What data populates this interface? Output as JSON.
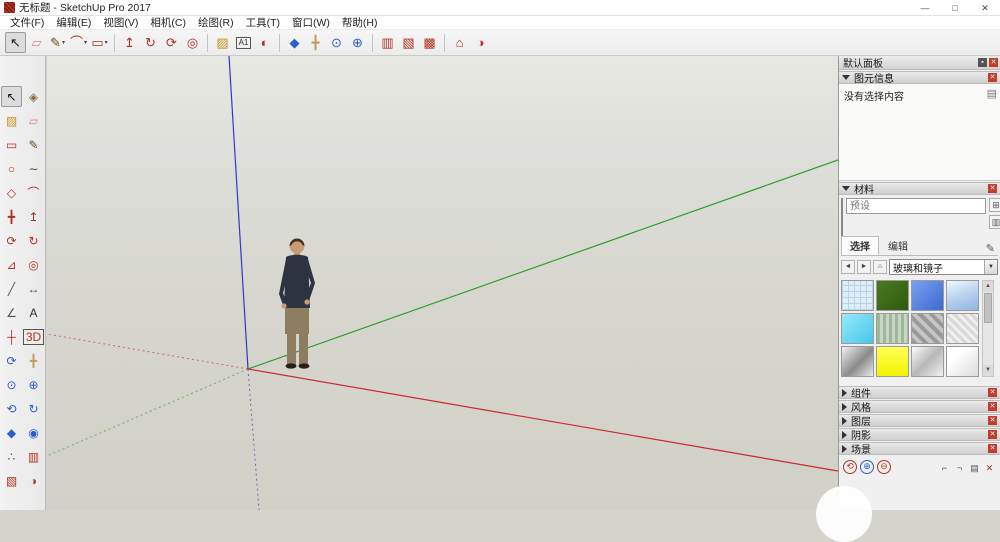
{
  "ui": {
    "minimize_glyph": "—",
    "maximize_glyph": "□",
    "close_glyph": "✕",
    "pin_glyph": "▪",
    "caret_small": "▾",
    "dropdown_caret": "▼",
    "back_arrow": "◄",
    "forward_arrow": "►",
    "home_glyph": "⌂",
    "pencil_glyph": "✎",
    "detail_toggle_glyph": "▤",
    "scroll_up": "▲",
    "scroll_down": "▼",
    "create_material_glyph": "⊞",
    "secondary_pane_glyph": "▥"
  },
  "titlebar": {
    "title": "无标题 - SketchUp Pro 2017"
  },
  "menu": {
    "items": [
      {
        "name": "menu-file",
        "label": "文件(F)"
      },
      {
        "name": "menu-edit",
        "label": "编辑(E)"
      },
      {
        "name": "menu-view",
        "label": "视图(V)"
      },
      {
        "name": "menu-camera",
        "label": "相机(C)"
      },
      {
        "name": "menu-draw",
        "label": "绘图(R)"
      },
      {
        "name": "menu-tools",
        "label": "工具(T)"
      },
      {
        "name": "menu-window",
        "label": "窗口(W)"
      },
      {
        "name": "menu-help",
        "label": "帮助(H)"
      }
    ]
  },
  "toolbar": {
    "items": [
      {
        "name": "select-tool-button",
        "glyph": "↖",
        "color": "#1a1a1a",
        "pressed": true
      },
      {
        "name": "eraser-tool-button",
        "glyph": "▱",
        "color": "#d87f7f"
      },
      {
        "name": "line-tool-button",
        "glyph": "✎",
        "color": "#6b4a1a",
        "caret": true
      },
      {
        "name": "arc-tool-button",
        "glyph": "⌒",
        "color": "#b23220",
        "caret": true
      },
      {
        "name": "rectangle-tool-button",
        "glyph": "▭",
        "color": "#b23220",
        "caret": true
      },
      {
        "type": "sep"
      },
      {
        "name": "push-pull-tool-button",
        "glyph": "↥",
        "color": "#b23220"
      },
      {
        "name": "follow-me-tool-button",
        "glyph": "↻",
        "color": "#b23220"
      },
      {
        "name": "rotate-tool-button",
        "glyph": "⟳",
        "color": "#b23220"
      },
      {
        "name": "offset-tool-button",
        "glyph": "◎",
        "color": "#b23220"
      },
      {
        "type": "sep"
      },
      {
        "name": "paint-bucket-tool-button",
        "glyph": "▨",
        "color": "#c8931f"
      },
      {
        "name": "text-tool-button",
        "glyph": "A1",
        "color": "#333333",
        "boxed": true
      },
      {
        "name": "orbit-tool-button",
        "glyph": "◐",
        "color": "#b23220"
      },
      {
        "type": "sep"
      },
      {
        "name": "position-camera-tool-button",
        "glyph": "◆",
        "color": "#2d5bd0"
      },
      {
        "name": "pan-tool-button",
        "glyph": "╋",
        "color": "#c79a5b"
      },
      {
        "name": "zoom-tool-button",
        "glyph": "⊙",
        "color": "#2d5bd0"
      },
      {
        "name": "zoom-extents-tool-button",
        "glyph": "⊕",
        "color": "#2d5bd0"
      },
      {
        "type": "sep"
      },
      {
        "name": "section-plane-tool-button",
        "glyph": "▥",
        "color": "#b23220"
      },
      {
        "name": "section-cut-display-button",
        "glyph": "▧",
        "color": "#b23220"
      },
      {
        "name": "section-fill-display-button",
        "glyph": "▩",
        "color": "#b23220"
      },
      {
        "type": "sep"
      },
      {
        "name": "views-tool-button",
        "glyph": "⌂",
        "color": "#b23220"
      },
      {
        "name": "shadows-toggle-button",
        "glyph": "◑",
        "color": "#c03030"
      }
    ]
  },
  "left_toolbar": {
    "items": [
      {
        "name": "lt-select-button",
        "glyph": "↖",
        "color": "#111111",
        "pressed": true
      },
      {
        "name": "lt-make-component-button",
        "glyph": "◈",
        "color": "#8a6a3a"
      },
      {
        "name": "lt-paint-bucket-button",
        "glyph": "▨",
        "color": "#c8931f"
      },
      {
        "name": "lt-eraser-button",
        "glyph": "▱",
        "color": "#d87f7f"
      },
      {
        "name": "lt-rectangle-button",
        "glyph": "▭",
        "color": "#b23220"
      },
      {
        "name": "lt-line-button",
        "glyph": "✎",
        "color": "#6b4a1a"
      },
      {
        "name": "lt-circle-button",
        "glyph": "○",
        "color": "#b23220"
      },
      {
        "name": "lt-freehand-button",
        "glyph": "∼",
        "color": "#6b4a1a"
      },
      {
        "name": "lt-polygon-button",
        "glyph": "◇",
        "color": "#b23220"
      },
      {
        "name": "lt-arc-button",
        "glyph": "⌒",
        "color": "#b23220"
      },
      {
        "name": "lt-move-button",
        "glyph": "╋",
        "color": "#b23220"
      },
      {
        "name": "lt-push-pull-button",
        "glyph": "↥",
        "color": "#b23220"
      },
      {
        "name": "lt-rotate-button",
        "glyph": "⟳",
        "color": "#b23220"
      },
      {
        "name": "lt-follow-me-button",
        "glyph": "↻",
        "color": "#b23220"
      },
      {
        "name": "lt-scale-button",
        "glyph": "⊿",
        "color": "#b23220"
      },
      {
        "name": "lt-offset-button",
        "glyph": "◎",
        "color": "#b23220"
      },
      {
        "name": "lt-tape-measure-button",
        "glyph": "╱",
        "color": "#555555"
      },
      {
        "name": "lt-dimension-button",
        "glyph": "↔",
        "color": "#555555"
      },
      {
        "name": "lt-protractor-button",
        "glyph": "∠",
        "color": "#555555"
      },
      {
        "name": "lt-text-button",
        "glyph": "A",
        "color": "#333333"
      },
      {
        "name": "lt-axes-button",
        "glyph": "┼",
        "color": "#b23220"
      },
      {
        "name": "lt-3d-text-button",
        "glyph": "3D",
        "color": "#b23220",
        "boxed": true
      },
      {
        "name": "lt-orbit-button",
        "glyph": "⟳",
        "color": "#2d5bd0"
      },
      {
        "name": "lt-pan-button",
        "glyph": "╋",
        "color": "#c79a5b"
      },
      {
        "name": "lt-zoom-button",
        "glyph": "⊙",
        "color": "#2d5bd0"
      },
      {
        "name": "lt-zoom-extents-button",
        "glyph": "⊕",
        "color": "#2d5bd0"
      },
      {
        "name": "lt-zoom-previous-button",
        "glyph": "⟲",
        "color": "#2d5bd0"
      },
      {
        "name": "lt-zoom-next-button",
        "glyph": "↻",
        "color": "#2d5bd0"
      },
      {
        "name": "lt-position-camera-button",
        "glyph": "◆",
        "color": "#2d5bd0"
      },
      {
        "name": "lt-look-around-button",
        "glyph": "◉",
        "color": "#2d5bd0"
      },
      {
        "name": "lt-walk-button",
        "glyph": "∴",
        "color": "#555555"
      },
      {
        "name": "lt-section-plane-button",
        "glyph": "▥",
        "color": "#b23220"
      },
      {
        "name": "lt-section-cut-button",
        "glyph": "▧",
        "color": "#b23220"
      },
      {
        "name": "lt-shadow-button",
        "glyph": "◑",
        "color": "#c03030"
      }
    ]
  },
  "viewport": {
    "axis_colors": {
      "red": "#cc2a2a",
      "green": "#2f9e2f",
      "blue": "#3535cc"
    }
  },
  "panel": {
    "title": "默认面板",
    "entity_info": {
      "title": "图元信息",
      "empty_message": "没有选择内容"
    },
    "materials": {
      "title": "材料",
      "name_placeholder": "预设",
      "tabs": {
        "select": "选择",
        "edit": "编辑"
      },
      "collection_value": "玻璃和镜子",
      "swatches": [
        {
          "name": "translucent-glass-grid",
          "css": "repeating-linear-gradient(0deg,#b8d4e6 0 1px,transparent 1px 6px),repeating-linear-gradient(90deg,#b8d4e6 0 1px,#ddeef8 1px 6px)"
        },
        {
          "name": "dark-green-glass",
          "css": "linear-gradient(135deg,#4a7a1e,#2e5a10)"
        },
        {
          "name": "blue-glass",
          "css": "linear-gradient(135deg,#7aa0f0,#3d6ad0)"
        },
        {
          "name": "sky-reflective-glass",
          "css": "linear-gradient(160deg,#f3f8fd 0%,#bdd5ef 45%,#8fb4e4 100%)"
        },
        {
          "name": "cyan-glass",
          "css": "linear-gradient(135deg,#9ae8f8,#45c8ec)"
        },
        {
          "name": "green-striped-glass",
          "css": "repeating-linear-gradient(90deg,#9eb89a 0 3px,#c9d6c3 3px 6px)"
        },
        {
          "name": "gray-pattern-glass",
          "css": "repeating-linear-gradient(45deg,#9a9a9a 0 4px,#c6c6c6 4px 8px)"
        },
        {
          "name": "light-obscure-glass",
          "css": "repeating-linear-gradient(45deg,#d9d9d9 0 3px,#f0f0f0 3px 6px)"
        },
        {
          "name": "mirror-gradient",
          "css": "linear-gradient(135deg,#f2f2f2 0%,#8a8a8a 55%,#eaeaea 100%)"
        },
        {
          "name": "yellow-glass",
          "css": "linear-gradient(180deg,#ffff55,#f3f300)"
        },
        {
          "name": "silver-mirror",
          "css": "linear-gradient(135deg,#fdfdfd 0%,#b8b8b8 50%,#f0f0f0 100%)"
        },
        {
          "name": "white-glass",
          "css": "linear-gradient(135deg,#ffffff 30%,#dcdcdc 100%)"
        }
      ]
    },
    "collapsed_sections": [
      {
        "name": "components",
        "label": "组件"
      },
      {
        "name": "styles",
        "label": "风格"
      },
      {
        "name": "layers",
        "label": "图层"
      },
      {
        "name": "shadows",
        "label": "阴影"
      },
      {
        "name": "scenes",
        "label": "场景"
      }
    ],
    "tray_buttons": [
      {
        "name": "tray-refresh-button",
        "glyph": "⟲",
        "color": "#b23220",
        "shape": "round"
      },
      {
        "name": "tray-add-button",
        "glyph": "⊕",
        "color": "#2d5bd0",
        "shape": "round"
      },
      {
        "name": "tray-remove-button",
        "glyph": "⊖",
        "color": "#b23220",
        "shape": "round"
      },
      {
        "name": "tray-dock-left-button",
        "glyph": "⌐",
        "color": "#555555",
        "shape": "flat"
      },
      {
        "name": "tray-dock-right-button",
        "glyph": "¬",
        "color": "#555555",
        "shape": "flat"
      },
      {
        "name": "tray-panel-list-button",
        "glyph": "▤",
        "color": "#555555",
        "shape": "flat"
      },
      {
        "name": "tray-close-button",
        "glyph": "✕",
        "color": "#b23220",
        "shape": "flat"
      }
    ]
  }
}
